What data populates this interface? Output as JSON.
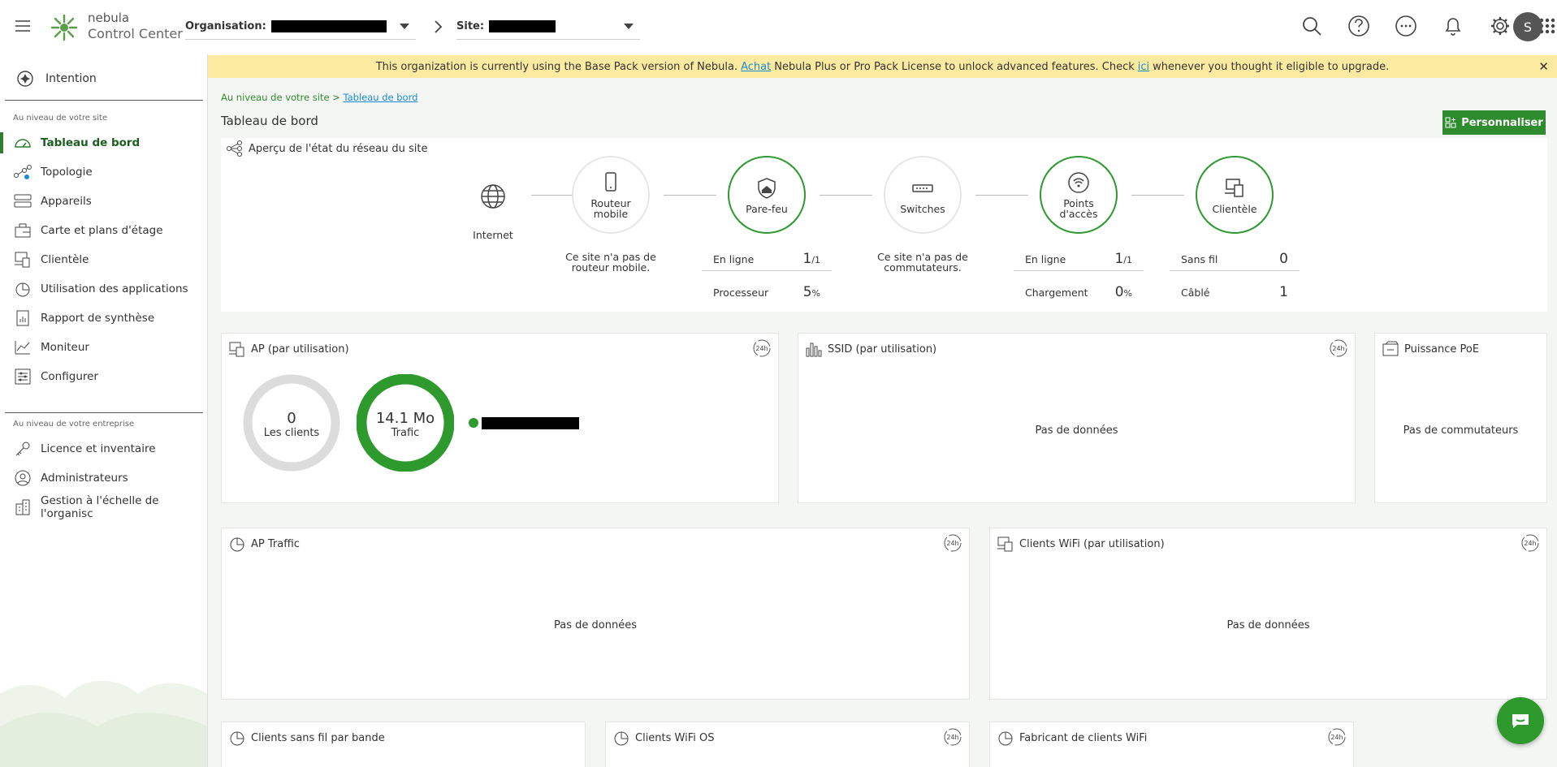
{
  "brand": {
    "line1": "nebula",
    "line2": "Control Center"
  },
  "header": {
    "org_label": "Organisation:",
    "site_label": "Site:",
    "user_initial": "S",
    "icons": [
      "search-icon",
      "help-icon",
      "more-icon",
      "bell-icon",
      "gear-icon",
      "apps-grid-icon"
    ]
  },
  "sidebar": {
    "intention": "Intention",
    "site_section": "Au niveau de votre site",
    "site_items": [
      {
        "label": "Tableau de bord",
        "icon": "dashboard-icon",
        "active": true
      },
      {
        "label": "Topologie",
        "icon": "topology-icon"
      },
      {
        "label": "Appareils",
        "icon": "devices-icon"
      },
      {
        "label": "Carte et plans d'étage",
        "icon": "map-icon"
      },
      {
        "label": "Clientèle",
        "icon": "clients-icon"
      },
      {
        "label": "Utilisation des applications",
        "icon": "pie-icon"
      },
      {
        "label": "Rapport de synthèse",
        "icon": "report-icon"
      },
      {
        "label": "Moniteur",
        "icon": "monitor-icon"
      },
      {
        "label": "Configurer",
        "icon": "configure-icon"
      }
    ],
    "org_section": "Au niveau de votre entreprise",
    "org_items": [
      {
        "label": "Licence et inventaire",
        "icon": "key-icon"
      },
      {
        "label": "Administrateurs",
        "icon": "admin-icon"
      },
      {
        "label": "Gestion à l'échelle de l'organisc",
        "icon": "building-icon"
      }
    ]
  },
  "banner": {
    "text1": "This organization is currently using the Base Pack version of Nebula.",
    "link1": "Achat",
    "text2": "Nebula Plus or Pro Pack License to unlock advanced features. Check",
    "link2": "ici",
    "text3": "whenever you thought it eligible to upgrade.",
    "close": "✕"
  },
  "main": {
    "breadcrumb_parent": "Au niveau de votre site >",
    "breadcrumb_current": "Tableau de bord",
    "title": "Tableau de bord",
    "customize_label": "Personnaliser"
  },
  "overview": {
    "title": "Aperçu de l'état du réseau du site",
    "internet": "Internet",
    "mobile_router": {
      "l1": "Routeur",
      "l2": "mobile",
      "note1": "Ce site n'a pas de",
      "note2": "routeur mobile."
    },
    "firewall": {
      "label": "Pare-feu",
      "online_k": "En ligne",
      "online_v": "1",
      "online_t": "/1",
      "cpu_k": "Processeur",
      "cpu_v": "5",
      "cpu_u": "%"
    },
    "switches": {
      "label": "Switches",
      "note1": "Ce site n'a pas de",
      "note2": "commutateurs."
    },
    "ap": {
      "l1": "Points",
      "l2": "d'accès",
      "online_k": "En ligne",
      "online_v": "1",
      "online_t": "/1",
      "load_k": "Chargement",
      "load_v": "0",
      "load_u": "%"
    },
    "clients": {
      "label": "Clientèle",
      "wireless_k": "Sans fil",
      "wireless_v": "0",
      "wired_k": "Câblé",
      "wired_v": "1"
    }
  },
  "widgets": {
    "badge": "24h",
    "ap_usage": {
      "title": "AP (par utilisation)",
      "clients_n": "0",
      "clients_t": "Les clients",
      "traffic_n": "14.1 Mo",
      "traffic_t": "Trafic"
    },
    "ssid": {
      "title": "SSID (par utilisation)",
      "empty": "Pas de données"
    },
    "poe": {
      "title": "Puissance PoE",
      "empty": "Pas de commutateurs"
    },
    "ap_traffic": {
      "title": "AP Traffic",
      "empty": "Pas de données"
    },
    "wifi_clients": {
      "title": "Clients WiFi (par utilisation)",
      "empty": "Pas de données"
    },
    "band": {
      "title": "Clients sans fil par bande"
    },
    "os": {
      "title": "Clients WiFi OS"
    },
    "manufacturer": {
      "title": "Fabricant de clients WiFi"
    }
  },
  "colors": {
    "accent": "#2e9a2e",
    "banner": "#fdeaa1",
    "link": "#1a8ad4"
  }
}
